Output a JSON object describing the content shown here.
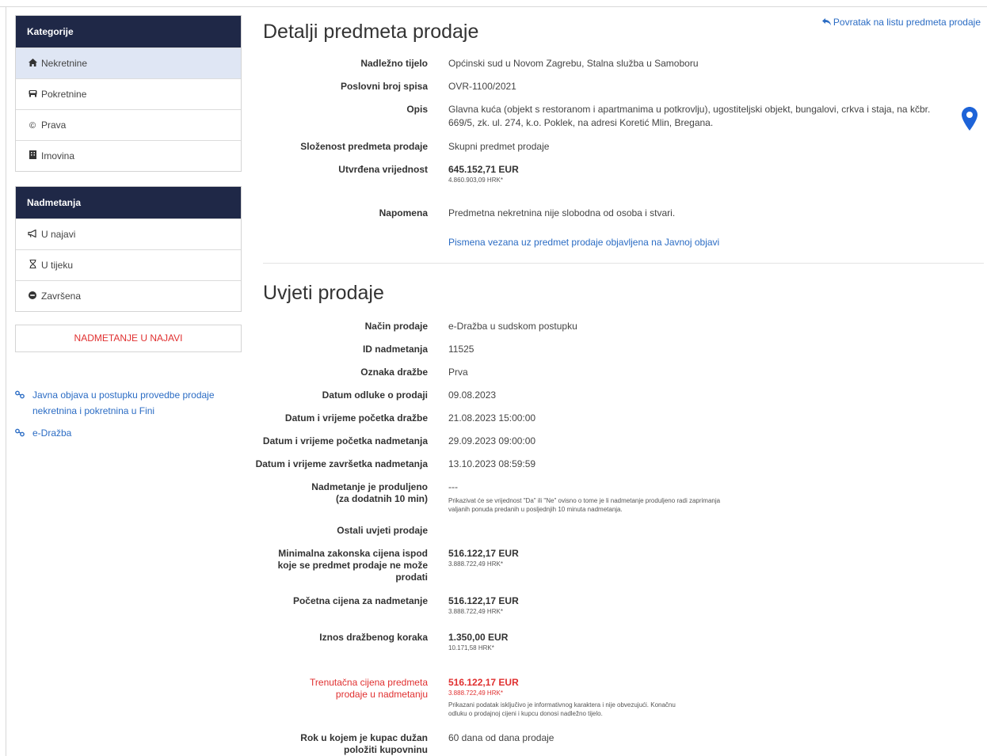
{
  "sidebar": {
    "kategorije": {
      "title": "Kategorije",
      "items": [
        {
          "label": "Nekretnine",
          "icon": "home-icon"
        },
        {
          "label": "Pokretnine",
          "icon": "car-icon"
        },
        {
          "label": "Prava",
          "icon": "copyright-icon"
        },
        {
          "label": "Imovina",
          "icon": "building-icon"
        }
      ]
    },
    "nadmetanja": {
      "title": "Nadmetanja",
      "items": [
        {
          "label": "U najavi",
          "icon": "megaphone-icon"
        },
        {
          "label": "U tijeku",
          "icon": "hourglass-icon"
        },
        {
          "label": "Završena",
          "icon": "minus-circle-icon"
        }
      ]
    },
    "status_button": "NADMETANJE U NAJAVI",
    "links": [
      {
        "label": "Javna objava u postupku provedbe prodaje nekretnina i pokretnina u Fini"
      },
      {
        "label": "e-Dražba"
      }
    ]
  },
  "header": {
    "back_link": "Povratak na listu predmeta prodaje",
    "title": "Detalji predmeta prodaje"
  },
  "details": {
    "nadlezno_label": "Nadležno tijelo",
    "nadlezno_value": "Općinski sud u Novom Zagrebu, Stalna služba u Samoboru",
    "broj_label": "Poslovni broj spisa",
    "broj_value": "OVR-1100/2021",
    "opis_label": "Opis",
    "opis_value": "Glavna kuća (objekt s restoranom i apartmanima u potkrovlju), ugostiteljski objekt, bungalovi, crkva i staja, na kčbr. 669/5, zk. ul. 274, k.o. Poklek, na adresi Koretić Mlin, Bregana.",
    "slozenost_label": "Složenost predmeta prodaje",
    "slozenost_value": "Skupni predmet prodaje",
    "vrijednost_label": "Utvrđena vrijednost",
    "vrijednost_eur": "645.152,71 EUR",
    "vrijednost_hrk": "4.860.903,09 HRK*",
    "napomena_label": "Napomena",
    "napomena_value": "Predmetna nekretnina nije slobodna od osoba i stvari.",
    "pismena_link": "Pismena vezana uz predmet prodaje objavljena na Javnoj objavi"
  },
  "conditions": {
    "title": "Uvjeti prodaje",
    "nacin_label": "Način prodaje",
    "nacin_value": "e-Dražba u sudskom postupku",
    "id_label": "ID nadmetanja",
    "id_value": "11525",
    "oznaka_label": "Oznaka dražbe",
    "oznaka_value": "Prva",
    "odluka_label": "Datum odluke o prodaji",
    "odluka_value": "09.08.2023",
    "pocetak_drazbe_label": "Datum i vrijeme početka dražbe",
    "pocetak_drazbe_value": "21.08.2023 15:00:00",
    "pocetak_nad_label": "Datum i vrijeme početka nadmetanja",
    "pocetak_nad_value": "29.09.2023 09:00:00",
    "zavrsetak_label": "Datum i vrijeme završetka nadmetanja",
    "zavrsetak_value": "13.10.2023 08:59:59",
    "produljeno_label": "Nadmetanje je produljeno (za dodatnih 10 min)",
    "produljeno_value": "---",
    "produljeno_note": "Prikazivat će se vrijednost \"Da\" ili \"Ne\" ovisno o tome je li nadmetanje produljeno radi zaprimanja valjanih ponuda predanih u posljednjih 10 minuta nadmetanja.",
    "ostali_label": "Ostali uvjeti prodaje",
    "minimalna_label": "Minimalna zakonska cijena ispod koje se predmet prodaje ne može prodati",
    "minimalna_eur": "516.122,17 EUR",
    "minimalna_hrk": "3.888.722,49 HRK*",
    "pocetna_label": "Početna cijena za nadmetanje",
    "pocetna_eur": "516.122,17 EUR",
    "pocetna_hrk": "3.888.722,49 HRK*",
    "korak_label": "Iznos dražbenog koraka",
    "korak_eur": "1.350,00 EUR",
    "korak_hrk": "10.171,58 HRK*",
    "trenutna_label": "Trenutačna cijena predmeta prodaje u nadmetanju",
    "trenutna_eur": "516.122,17 EUR",
    "trenutna_hrk": "3.888.722,49 HRK*",
    "trenutna_note": "Prikazani podatak isključivo je informativnog karaktera i nije obvezujući. Konačnu odluku o prodajnoj cijeni i kupcu donosi nadležno tijelo.",
    "rok_label": "Rok u kojem je kupac dužan položiti kupovninu",
    "rok_value": "60 dana od dana prodaje"
  },
  "colors": {
    "nav_dark": "#1f2847",
    "link": "#2b6cc4",
    "alert": "#e03030",
    "active": "#dfe6f4"
  }
}
